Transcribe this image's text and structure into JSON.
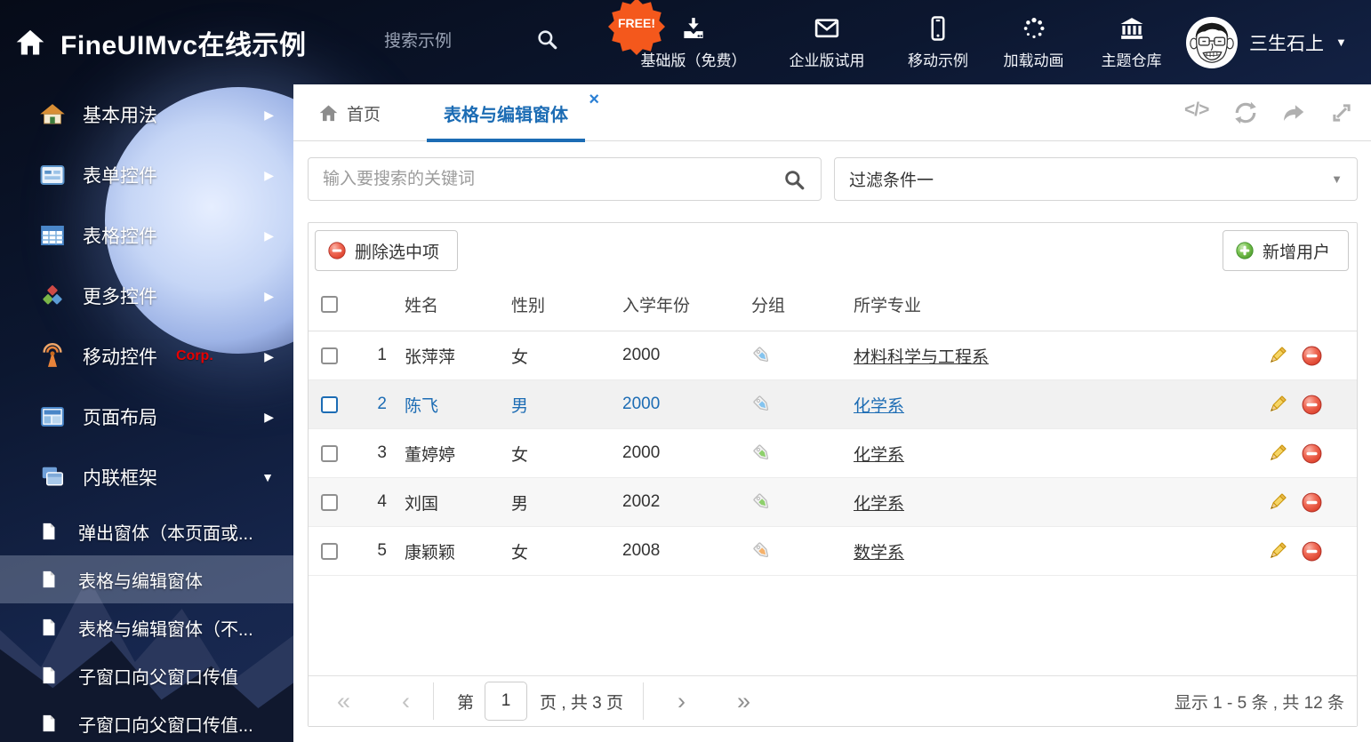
{
  "header": {
    "logo_title": "FineUIMvc在线示例",
    "search_placeholder": "搜索示例",
    "free_badge": "FREE!",
    "nav_items": [
      {
        "label": "基础版（免费）",
        "icon": "download-icon"
      },
      {
        "label": "企业版试用",
        "icon": "envelope-icon"
      },
      {
        "label": "移动示例",
        "icon": "mobile-icon"
      },
      {
        "label": "加载动画",
        "icon": "spinner-icon"
      },
      {
        "label": "主题仓库",
        "icon": "bank-icon"
      }
    ],
    "user_name": "三生石上",
    "user_caret": "▼"
  },
  "sidebar": {
    "items": [
      {
        "label": "基本用法",
        "icon": "house-icon",
        "arrow": "▶"
      },
      {
        "label": "表单控件",
        "icon": "form-icon",
        "arrow": "▶"
      },
      {
        "label": "表格控件",
        "icon": "table-icon",
        "arrow": "▶"
      },
      {
        "label": "更多控件",
        "icon": "cubes-icon",
        "arrow": "▶"
      },
      {
        "label": "移动控件",
        "badge": "Corp.",
        "icon": "antenna-icon",
        "arrow": "▶"
      },
      {
        "label": "页面布局",
        "icon": "layout-icon",
        "arrow": "▶"
      },
      {
        "label": "内联框架",
        "icon": "frames-icon",
        "arrow": "▼"
      }
    ],
    "subitems": [
      {
        "label": "弹出窗体（本页面或..."
      },
      {
        "label": "表格与编辑窗体",
        "active": true
      },
      {
        "label": "表格与编辑窗体（不..."
      },
      {
        "label": "子窗口向父窗口传值"
      },
      {
        "label": "子窗口向父窗口传值..."
      }
    ]
  },
  "tabs": {
    "home_label": "首页",
    "active_label": "表格与编辑窗体",
    "close_glyph": "×"
  },
  "content_icons": {
    "code_glyph": "</>"
  },
  "filters": {
    "search_placeholder": "输入要搜索的关键词",
    "filter_selected": "过滤条件一",
    "caret": "▼"
  },
  "toolbar": {
    "delete_label": "删除选中项",
    "add_label": "新增用户"
  },
  "table": {
    "columns": [
      "姓名",
      "性别",
      "入学年份",
      "分组",
      "所学专业"
    ],
    "rows": [
      {
        "num": "1",
        "name": "张萍萍",
        "gender": "女",
        "year": "2000",
        "tag_color": "#85c4ef",
        "major": "材料科学与工程系",
        "selected": false
      },
      {
        "num": "2",
        "name": "陈飞",
        "gender": "男",
        "year": "2000",
        "tag_color": "#85c4ef",
        "major": "化学系",
        "selected": true
      },
      {
        "num": "3",
        "name": "董婷婷",
        "gender": "女",
        "year": "2000",
        "tag_color": "#8ed06c",
        "major": "化学系",
        "selected": false
      },
      {
        "num": "4",
        "name": "刘国",
        "gender": "男",
        "year": "2002",
        "tag_color": "#8ed06c",
        "major": "化学系",
        "selected": false
      },
      {
        "num": "5",
        "name": "康颖颖",
        "gender": "女",
        "year": "2008",
        "tag_color": "#f6b26b",
        "major": "数学系",
        "selected": false
      }
    ]
  },
  "pagination": {
    "first_glyph": "«",
    "prev_glyph": "‹",
    "next_glyph": "›",
    "last_glyph": "»",
    "page_prefix": "第",
    "current_page": "1",
    "page_suffix": "页 , 共 3 页",
    "summary": "显示 1 - 5 条 , 共 12 条"
  },
  "colors": {
    "accent_blue": "#1c6cb4",
    "corp_red": "#e60000",
    "free_orange": "#f4581c",
    "tag_blue": "#85c4ef",
    "tag_green": "#8ed06c",
    "tag_orange": "#f6b26b",
    "delete_red": "#d93a25",
    "add_green": "#4d9a2a"
  }
}
